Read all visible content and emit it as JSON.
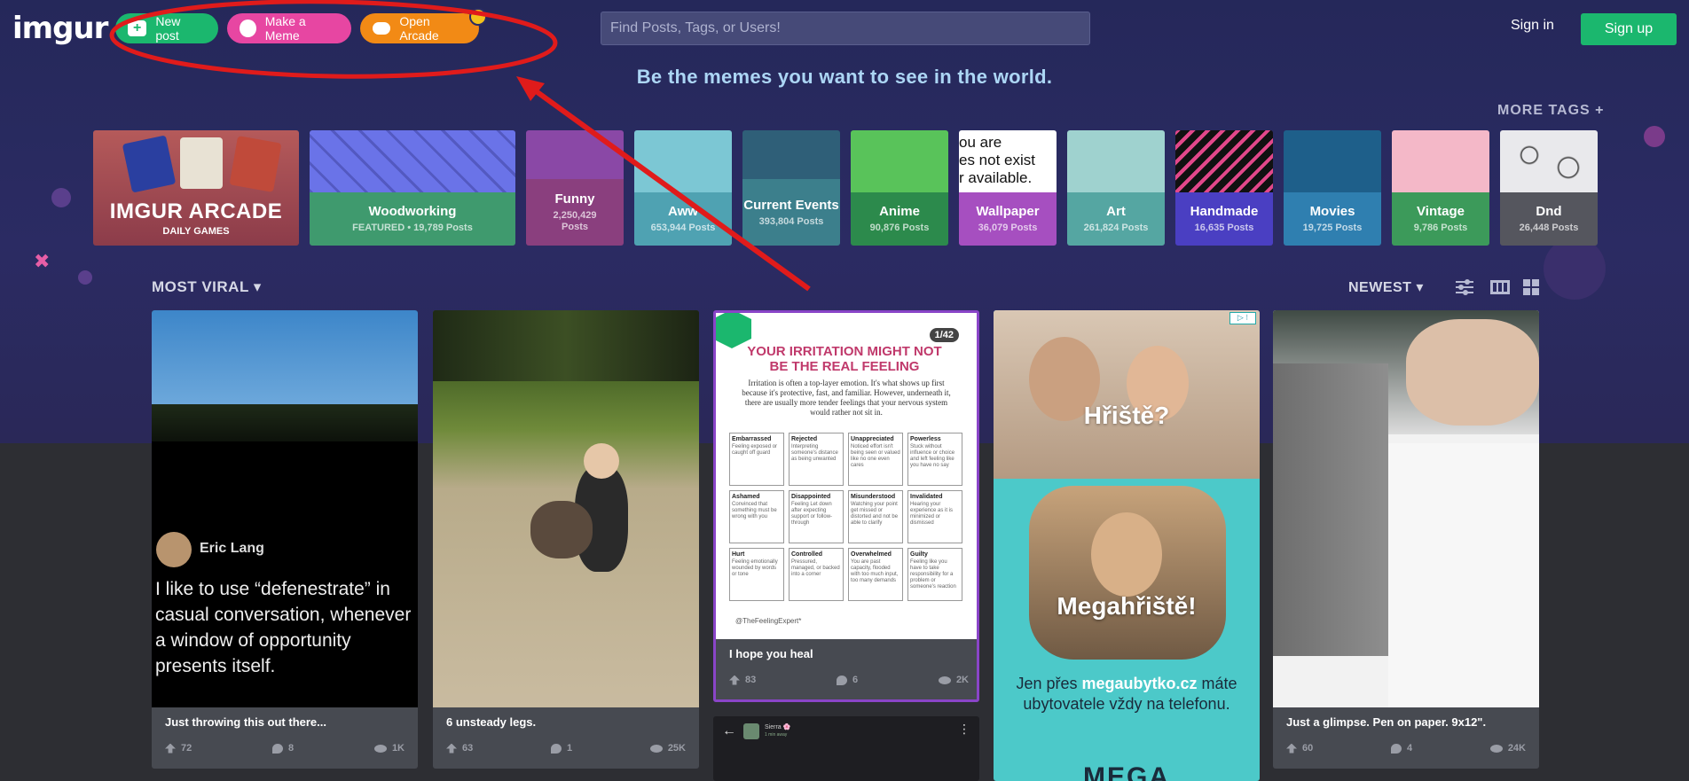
{
  "header": {
    "logo": "imgur",
    "new_post": "New post",
    "make_meme": "Make a Meme",
    "open_arcade": "Open Arcade",
    "search_placeholder": "Find Posts, Tags, or Users!",
    "sign_in": "Sign in",
    "sign_up": "Sign up"
  },
  "tagline": "Be the memes you want to see in the world.",
  "more_tags": "MORE TAGS +",
  "arcade_tile": {
    "title": "IMGUR ARCADE",
    "subtitle": "DAILY GAMES"
  },
  "tags": [
    {
      "name": "Woodworking",
      "count": "FEATURED • 19,789 Posts",
      "color": "#3f9a6e"
    },
    {
      "name": "Funny",
      "count": "2,250,429 Posts",
      "color": "#8a3f7e"
    },
    {
      "name": "Aww",
      "count": "653,944 Posts",
      "color": "#4fa2b2"
    },
    {
      "name": "Current Events",
      "count": "393,804 Posts",
      "color": "#3c7f8c"
    },
    {
      "name": "Anime",
      "count": "90,876 Posts",
      "color": "#2c8a4c"
    },
    {
      "name": "Wallpaper",
      "count": "36,079 Posts",
      "color": "#a64fc0"
    },
    {
      "name": "Art",
      "count": "261,824 Posts",
      "color": "#55a6a2"
    },
    {
      "name": "Handmade",
      "count": "16,635 Posts",
      "color": "#4a3fc2"
    },
    {
      "name": "Movies",
      "count": "19,725 Posts",
      "color": "#2f7fb0"
    },
    {
      "name": "Vintage",
      "count": "9,786 Posts",
      "color": "#3c9a5a"
    },
    {
      "name": "Dnd",
      "count": "26,448 Posts",
      "color": "#55565e"
    }
  ],
  "wallpaper_art_text": "ou are\nes not exist\nr available.",
  "section": {
    "most_viral": "MOST VIRAL",
    "newest": "NEWEST"
  },
  "posts": [
    {
      "title": "Just throwing this out there...",
      "up": "72",
      "comments": "8",
      "views": "1K",
      "author": "Eric Lang",
      "quote": "I like to use “defenestrate” in casual conversation, whenever a window of opportunity presents itself."
    },
    {
      "title": "6 unsteady legs.",
      "up": "63",
      "comments": "1",
      "views": "25K"
    },
    {
      "title": "I hope you heal",
      "up": "83",
      "comments": "6",
      "views": "2K",
      "counter": "1/42",
      "card_heading": "YOUR IRRITATION MIGHT NOT BE THE REAL FEELING",
      "card_intro": "Irritation is often a top-layer emotion. It's what shows up first because it's protective, fast, and familiar. However, underneath it, there are usually more tender feelings that your nervous system would rather not sit in.",
      "cells": [
        {
          "h": "Embarrassed",
          "t": "Feeling exposed or caught off guard"
        },
        {
          "h": "Rejected",
          "t": "Interpreting someone's distance as being unwanted"
        },
        {
          "h": "Unappreciated",
          "t": "Noticed effort isn't being seen or valued like no one even cares"
        },
        {
          "h": "Powerless",
          "t": "Stuck without influence or choice and left feeling like you have no say"
        },
        {
          "h": "Ashamed",
          "t": "Convinced that something must be wrong with you"
        },
        {
          "h": "Disappointed",
          "t": "Feeling Let down after expecting support or follow-through"
        },
        {
          "h": "Misunderstood",
          "t": "Watching your point get missed or distorted and not be able to clarify"
        },
        {
          "h": "Invalidated",
          "t": "Hearing your experience as it is minimized or dismissed"
        },
        {
          "h": "Hurt",
          "t": "Feeling emotionally wounded by words or tone"
        },
        {
          "h": "Controlled",
          "t": "Pressured, managed, or backed into a corner"
        },
        {
          "h": "Overwhelmed",
          "t": "You are past capacity, flooded with too much input, too many demands"
        },
        {
          "h": "Guilty",
          "t": "Feeling like you have to take responsibility for a problem or someone's reaction"
        }
      ],
      "card_footer": "@TheFeelingExpert*"
    },
    {
      "ad": true,
      "ad_text1": "Hřiště?",
      "ad_text2": "Megahřiště!",
      "ad_text3_pre": "Jen přes ",
      "ad_link": "megaubytko.cz",
      "ad_text3_post": " máte ubytovatele vždy na telefonu.",
      "ad_brand": "MEGA"
    },
    {
      "title": "Just a glimpse. Pen on paper. 9x12\".",
      "up": "60",
      "comments": "4",
      "views": "24K"
    }
  ],
  "extra_card": {
    "user": "Sierra 🌸",
    "time": "1 min away"
  },
  "colors": {
    "accent_green": "#1bb76e",
    "meme_pink": "#e746a2",
    "arcade_orange": "#f28a15",
    "annotation_red": "#e01b1b"
  }
}
